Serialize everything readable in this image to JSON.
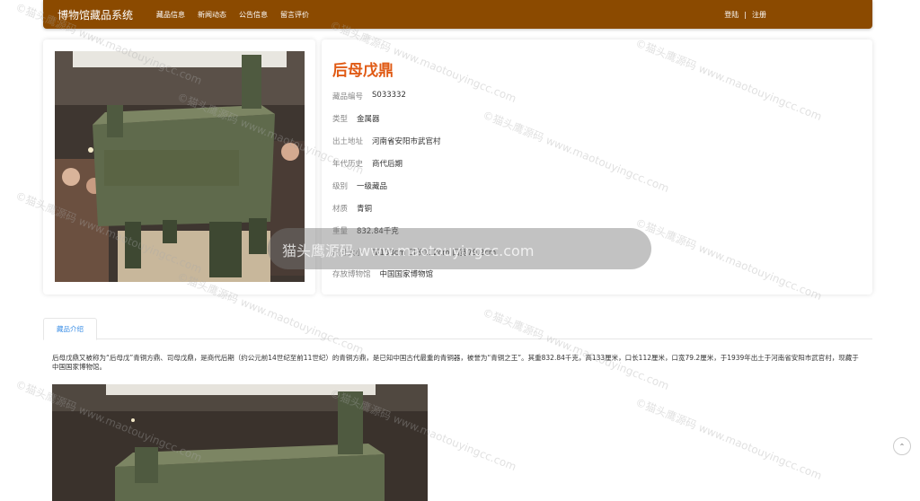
{
  "nav": {
    "brand": "博物馆藏品系统",
    "links": [
      "藏品信息",
      "新闻动态",
      "公告信息",
      "留言评价"
    ],
    "login": "登陆",
    "separator": "|",
    "register": "注册"
  },
  "item": {
    "title": "后母戊鼎",
    "fields": [
      {
        "label": "藏品编号",
        "value": "S033332"
      },
      {
        "label": "类型",
        "value": "金属器"
      },
      {
        "label": "出土地址",
        "value": "河南省安阳市武官村"
      },
      {
        "label": "年代历史",
        "value": "商代后期"
      },
      {
        "label": "级别",
        "value": "一级藏品"
      },
      {
        "label": "材质",
        "value": "青铜"
      },
      {
        "label": "重量",
        "value": "832.84千克"
      },
      {
        "label": "尺寸大小",
        "value": "高133cm 口长112cm 口宽79.2cm"
      },
      {
        "label": "存放博物馆",
        "value": "中国国家博物馆"
      }
    ]
  },
  "tabs": {
    "intro": "藏品介绍"
  },
  "description": "后母戊鼎又被称为“后母戊”青铜方鼎、司母戊鼎，是商代后期（约公元前14世纪至前11世纪）的青铜方鼎，是已知中国古代最重的青铜器，被誉为“青铜之王”。其重832.84千克，高133厘米，口长112厘米，口宽79.2厘米，于1939年出土于河南省安阳市武官村，现藏于中国国家博物馆。",
  "overlay_text": "猫头鹰源码 www.maotouyingcc.com",
  "watermark": "©猫头鹰源码 www.maotouyingcc.com",
  "colors": {
    "navbar": "#8b4a00",
    "title": "#e05a14",
    "tab": "#3a8ee6"
  },
  "icons": {
    "scroll_top": "chevron-up-icon"
  }
}
